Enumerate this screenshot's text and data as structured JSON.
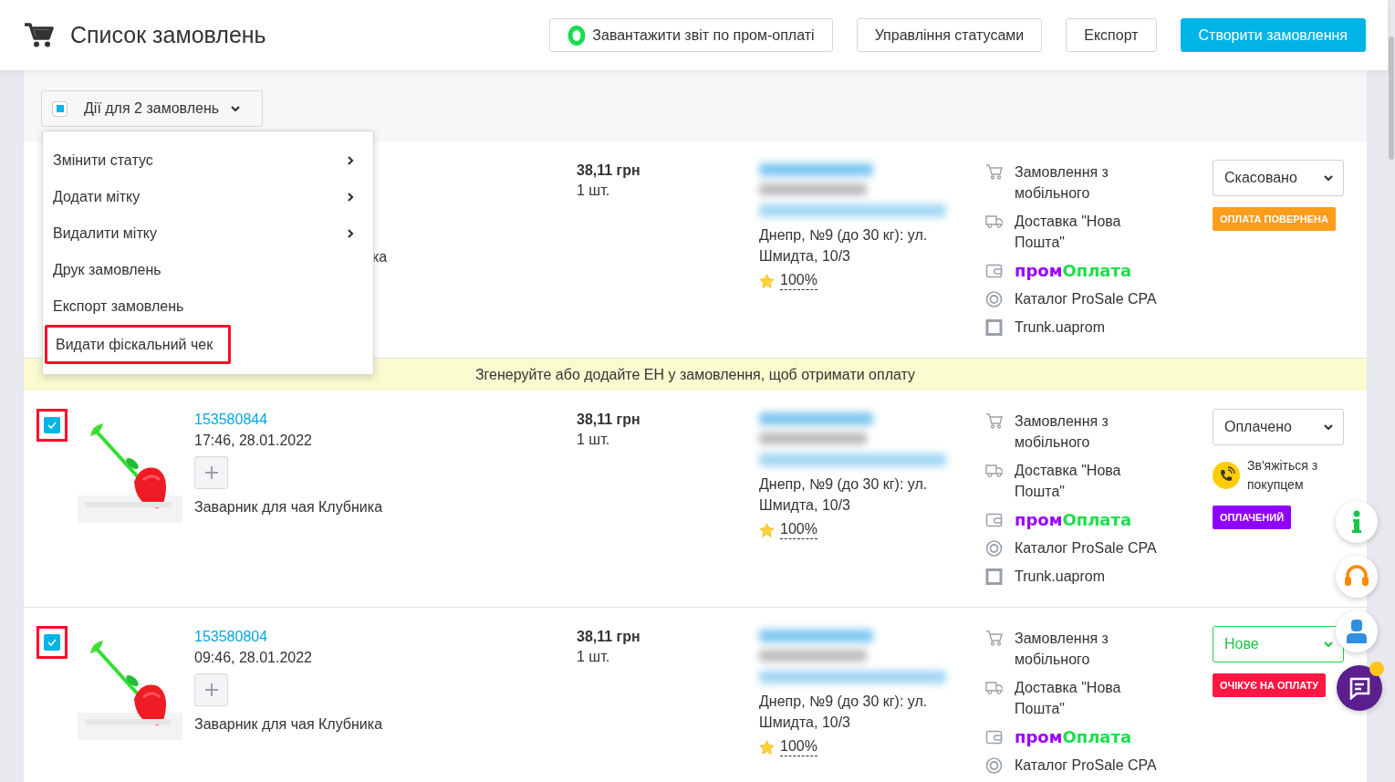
{
  "header": {
    "title": "Список замовлень",
    "buttons": [
      {
        "label": "Завантажити звіт по пром-оплаті",
        "kind": "report"
      },
      {
        "label": "Управління статусами",
        "kind": "plain"
      },
      {
        "label": "Експорт",
        "kind": "plain"
      },
      {
        "label": "Створити замовлення",
        "kind": "primary"
      }
    ]
  },
  "bulk": {
    "label": "Дії для 2 замовлень",
    "indeterminate": true,
    "menu": [
      {
        "label": "Змінити статус",
        "submenu": true,
        "highlighted": false
      },
      {
        "label": "Додати мітку",
        "submenu": true,
        "highlighted": false
      },
      {
        "label": "Видалити мітку",
        "submenu": true,
        "highlighted": false
      },
      {
        "label": "Друк замовлень",
        "submenu": false,
        "highlighted": false
      },
      {
        "label": "Експорт замовлень",
        "submenu": false,
        "highlighted": false
      },
      {
        "label": "Видати фіскальний чек",
        "submenu": false,
        "highlighted": true
      }
    ]
  },
  "orders": [
    {
      "covered": true,
      "product_fragment": "ка",
      "price": "38,11 грн",
      "qty": "1 шт.",
      "address": "Днепр, №9 (до 30 кг): ул. Шмидта, 10/3",
      "rating": "100%",
      "sources": [
        {
          "kind": "cart",
          "text": "Замовлення з мобільного"
        },
        {
          "kind": "truck",
          "text": "Доставка \"Нова Пошта\""
        },
        {
          "kind": "wallet",
          "text_a": "пром",
          "text_b": "Оплата"
        },
        {
          "kind": "target",
          "text": "Каталог ProSale CPA"
        },
        {
          "kind": "square",
          "text": "Trunk.uaprom"
        }
      ],
      "status": {
        "label": "Скасовано",
        "kind": "default"
      },
      "badge": {
        "label": "ОПЛАТА ПОВЕРНЕНА",
        "color": "#ff9c1a"
      }
    },
    {
      "notice": "Згенеруйте або додайте ЕН у замовлення, щоб отримати оплату",
      "checked": true,
      "highlighted": true,
      "id": "153580844",
      "date": "17:46, 28.01.2022",
      "product": "Заварник для чая Клубника",
      "price": "38,11 грн",
      "qty": "1 шт.",
      "address": "Днепр, №9 (до 30 кг): ул. Шмидта, 10/3",
      "rating": "100%",
      "sources": [
        {
          "kind": "cart",
          "text": "Замовлення з мобільного"
        },
        {
          "kind": "truck",
          "text": "Доставка \"Нова Пошта\""
        },
        {
          "kind": "wallet",
          "text_a": "пром",
          "text_b": "Оплата"
        },
        {
          "kind": "target",
          "text": "Каталог ProSale CPA"
        },
        {
          "kind": "square",
          "text": "Trunk.uaprom"
        }
      ],
      "status": {
        "label": "Оплачено",
        "kind": "default"
      },
      "contact": "Зв'яжіться з покупцем",
      "badge": {
        "label": "ОПЛАЧЕНИЙ",
        "color": "#8f00ff"
      }
    },
    {
      "checked": true,
      "highlighted": true,
      "id": "153580804",
      "date": "09:46, 28.01.2022",
      "product": "Заварник для чая Клубника",
      "price": "38,11 грн",
      "qty": "1 шт.",
      "address": "Днепр, №9 (до 30 кг): ул. Шмидта, 10/3",
      "rating": "100%",
      "sources": [
        {
          "kind": "cart",
          "text": "Замовлення з мобільного"
        },
        {
          "kind": "truck",
          "text": "Доставка \"Нова Пошта\""
        },
        {
          "kind": "wallet",
          "text_a": "пром",
          "text_b": "Оплата"
        },
        {
          "kind": "target",
          "text": "Каталог ProSale CPA"
        }
      ],
      "status": {
        "label": "Нове",
        "kind": "new"
      },
      "badge": {
        "label": "ОЧІКУЄ НА ОПЛАТУ",
        "color": "#ff1744"
      }
    }
  ]
}
